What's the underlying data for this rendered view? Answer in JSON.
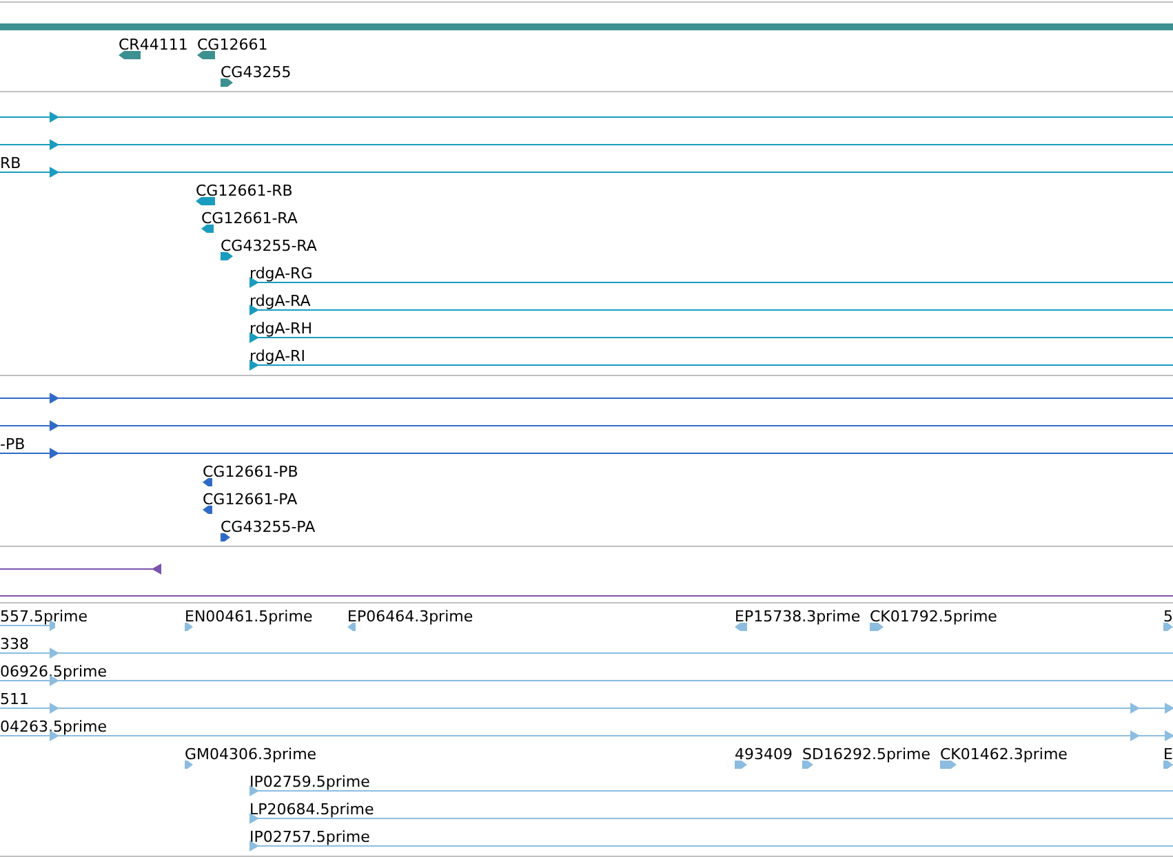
{
  "tracks": [
    {
      "color": "#3d9090",
      "rows": [
        {
          "features": [
            {
              "kind": "bar"
            }
          ]
        },
        {
          "features": [
            {
              "kind": "block",
              "label": "CR44111",
              "reverse": true
            },
            {
              "kind": "block",
              "label": "CG12661",
              "reverse": true
            }
          ]
        },
        {
          "features": [
            {
              "kind": "block",
              "label": "CG43255",
              "reverse": false
            }
          ]
        }
      ]
    },
    {
      "color": "#1a9cbf",
      "rows": [
        {
          "features": [
            {
              "kind": "span",
              "reverse": false
            }
          ]
        },
        {
          "features": [
            {
              "kind": "span",
              "reverse": false
            }
          ]
        },
        {
          "features": [
            {
              "kind": "span",
              "label": "RB",
              "reverse": false
            }
          ]
        },
        {
          "features": [
            {
              "kind": "block",
              "label": "CG12661-RB",
              "reverse": true
            }
          ]
        },
        {
          "features": [
            {
              "kind": "block",
              "label": "CG12661-RA",
              "reverse": true
            }
          ]
        },
        {
          "features": [
            {
              "kind": "block",
              "label": "CG43255-RA",
              "reverse": false
            }
          ]
        },
        {
          "features": [
            {
              "kind": "span",
              "label": "rdgA-RG",
              "reverse": false
            }
          ]
        },
        {
          "features": [
            {
              "kind": "span",
              "label": "rdgA-RA",
              "reverse": false
            }
          ]
        },
        {
          "features": [
            {
              "kind": "span",
              "label": "rdgA-RH",
              "reverse": false
            }
          ]
        },
        {
          "features": [
            {
              "kind": "span",
              "label": "rdgA-RI",
              "reverse": false
            }
          ]
        }
      ]
    },
    {
      "color": "#2f6bc6",
      "rows": [
        {
          "features": [
            {
              "kind": "span",
              "reverse": false
            }
          ]
        },
        {
          "features": [
            {
              "kind": "span",
              "reverse": false
            }
          ]
        },
        {
          "features": [
            {
              "kind": "span",
              "label": "-PB",
              "reverse": false
            }
          ]
        },
        {
          "features": [
            {
              "kind": "block",
              "label": "CG12661-PB",
              "reverse": true
            }
          ]
        },
        {
          "features": [
            {
              "kind": "block",
              "label": "CG12661-PA",
              "reverse": true
            }
          ]
        },
        {
          "features": [
            {
              "kind": "block",
              "label": "CG43255-PA",
              "reverse": false
            }
          ]
        }
      ]
    },
    {
      "color": "#7b52ae",
      "rows": [
        {
          "features": [
            {
              "kind": "span",
              "reverse": true
            }
          ]
        }
      ]
    },
    {
      "color": "#8cbde0",
      "rows": [
        {
          "features": [
            {
              "kind": "span",
              "label": "557.5prime",
              "reverse": false
            },
            {
              "kind": "block",
              "label": "EN00461.5prime",
              "reverse": false
            },
            {
              "kind": "block",
              "label": "EP06464.3prime",
              "reverse": true
            },
            {
              "kind": "block",
              "label": "EP15738.3prime",
              "reverse": true
            },
            {
              "kind": "block",
              "label": "CK01792.5prime",
              "reverse": false
            },
            {
              "kind": "block",
              "label": "5",
              "reverse": false
            }
          ]
        },
        {
          "features": [
            {
              "kind": "span",
              "label": "338",
              "reverse": false
            }
          ]
        },
        {
          "features": [
            {
              "kind": "span",
              "label": "06926.5prime",
              "reverse": false
            }
          ]
        },
        {
          "features": [
            {
              "kind": "span",
              "label": "511",
              "reverse": false
            }
          ]
        },
        {
          "features": [
            {
              "kind": "span",
              "label": "04263.5prime",
              "reverse": false
            }
          ]
        },
        {
          "features": [
            {
              "kind": "block",
              "label": "GM04306.3prime",
              "reverse": false
            },
            {
              "kind": "block",
              "label": "493409",
              "reverse": false
            },
            {
              "kind": "block",
              "label": "SD16292.5prime",
              "reverse": false
            },
            {
              "kind": "block",
              "label": "CK01462.3prime",
              "reverse": false
            },
            {
              "kind": "block",
              "label": "E",
              "reverse": false
            }
          ]
        },
        {
          "features": [
            {
              "kind": "span",
              "label": "IP02759.5prime",
              "reverse": false
            }
          ]
        },
        {
          "features": [
            {
              "kind": "span",
              "label": "LP20684.5prime",
              "reverse": false
            }
          ]
        },
        {
          "features": [
            {
              "kind": "span",
              "label": "IP02757.5prime",
              "reverse": false
            }
          ]
        }
      ]
    }
  ]
}
